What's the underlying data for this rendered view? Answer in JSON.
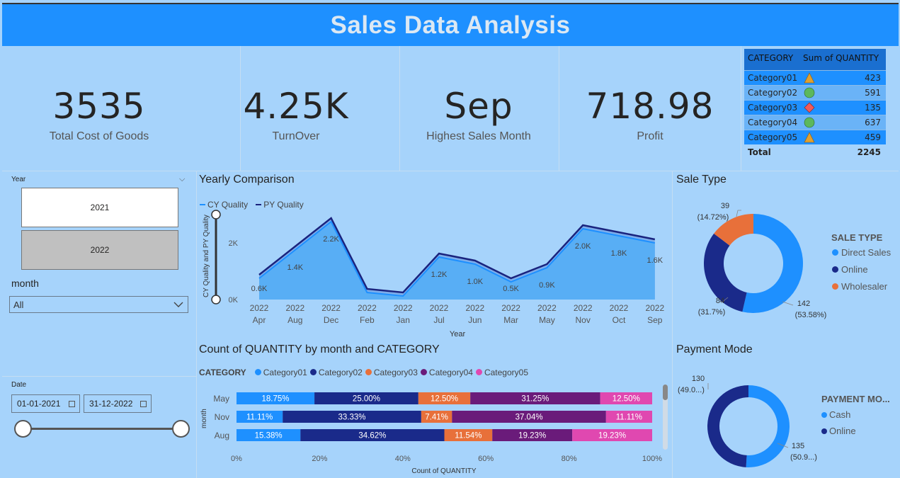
{
  "header": {
    "title": "Sales Data Analysis"
  },
  "kpis": [
    {
      "value": "3535",
      "label": "Total Cost of Goods"
    },
    {
      "value": "4.25K",
      "label": "TurnOver"
    },
    {
      "value": "Sep",
      "label": "Highest Sales Month"
    },
    {
      "value": "718.98",
      "label": "Profit"
    }
  ],
  "category_table": {
    "headers": [
      "CATEGORY",
      "Sum of QUANTITY"
    ],
    "rows": [
      {
        "name": "Category01",
        "icon": "triangle-warning-icon",
        "qty": "423"
      },
      {
        "name": "Category02",
        "icon": "circle-ok-icon",
        "qty": "591"
      },
      {
        "name": "Category03",
        "icon": "diamond-alert-icon",
        "qty": "135"
      },
      {
        "name": "Category04",
        "icon": "circle-ok-icon",
        "qty": "637"
      },
      {
        "name": "Category05",
        "icon": "triangle-warning-icon",
        "qty": "459"
      }
    ],
    "total_label": "Total",
    "total_value": "2245",
    "colors": {
      "triangle": "#e0a030",
      "circle": "#5cb85c",
      "diamond": "#ef5a5a"
    }
  },
  "year_slicer": {
    "label": "Year",
    "options": [
      "2021",
      "2022"
    ],
    "selected": "2022"
  },
  "month_slicer": {
    "label": "month",
    "value": "All"
  },
  "date_slicer": {
    "label": "Date",
    "start": "01-01-2021",
    "end": "31-12-2022"
  },
  "yearly": {
    "title": "Yearly Comparison",
    "legend": [
      "CY Quality",
      "PY Quality"
    ],
    "ylabel": "CY Quality and PY Quality",
    "xlabel": "Year",
    "yticks": [
      "2K",
      "0K"
    ]
  },
  "sale_type": {
    "title": "Sale Type",
    "legend_title": "SALE TYPE",
    "labels": [
      "Direct Sales",
      "Online",
      "Wholesaler"
    ],
    "value_labels": [
      {
        "value": "142",
        "pct": "(53.58%)"
      },
      {
        "value": "84",
        "pct": "(31.7%)"
      },
      {
        "value": "39",
        "pct": "(14.72%)"
      }
    ]
  },
  "payment": {
    "title": "Payment Mode",
    "legend_title": "PAYMENT MO...",
    "labels": [
      "Cash",
      "Online"
    ],
    "value_labels": [
      {
        "value": "135",
        "pct": "(50.9...)"
      },
      {
        "value": "130",
        "pct": "(49.0...)"
      }
    ]
  },
  "stacked": {
    "title": "Count of QUANTITY by month and CATEGORY",
    "legend_title": "CATEGORY",
    "ylabel": "month",
    "xlabel": "Count of QUANTITY",
    "xticks": [
      "0%",
      "20%",
      "40%",
      "60%",
      "80%",
      "100%"
    ]
  },
  "chart_data": [
    {
      "type": "area",
      "title": "Yearly Comparison",
      "categories": [
        "2022 Apr",
        "2022 Aug",
        "2022 Dec",
        "2022 Feb",
        "2022 Jan",
        "2022 Jul",
        "2022 Jun",
        "2022 Mar",
        "2022 May",
        "2022 Nov",
        "2022 Oct",
        "2022 Sep"
      ],
      "category_lines": [
        [
          "2022",
          "Apr"
        ],
        [
          "2022",
          "Aug"
        ],
        [
          "2022",
          "Dec"
        ],
        [
          "2022",
          "Feb"
        ],
        [
          "2022",
          "Jan"
        ],
        [
          "2022",
          "Jul"
        ],
        [
          "2022",
          "Jun"
        ],
        [
          "2022",
          "Mar"
        ],
        [
          "2022",
          "May"
        ],
        [
          "2022",
          "Nov"
        ],
        [
          "2022",
          "Oct"
        ],
        [
          "2022",
          "Sep"
        ]
      ],
      "series": [
        {
          "name": "CY Quality",
          "values": [
            0.6,
            1.4,
            2.2,
            0.2,
            0.1,
            1.2,
            1.0,
            0.5,
            0.9,
            2.0,
            1.8,
            1.6
          ]
        },
        {
          "name": "PY Quality",
          "values": [
            0.7,
            1.5,
            2.3,
            0.3,
            0.2,
            1.3,
            1.1,
            0.6,
            1.0,
            2.1,
            1.9,
            1.7
          ]
        }
      ],
      "data_labels": [
        "0.6K",
        "1.4K",
        "2.2K",
        "",
        "",
        "1.2K",
        "1.0K",
        "0.5K",
        "0.9K",
        "2.0K",
        "1.8K",
        "1.6K"
      ],
      "ylim": [
        0,
        2.4
      ],
      "colors": [
        "#1e90ff",
        "#1a237e"
      ]
    },
    {
      "type": "pie",
      "title": "Sale Type",
      "labels": [
        "Direct Sales",
        "Online",
        "Wholesaler"
      ],
      "values": [
        142,
        84,
        39
      ],
      "colors": [
        "#1e90ff",
        "#1a2a8a",
        "#e8703a"
      ]
    },
    {
      "type": "pie",
      "title": "Payment Mode",
      "labels": [
        "Cash",
        "Online"
      ],
      "values": [
        135,
        130
      ],
      "colors": [
        "#1e90ff",
        "#1a2a8a"
      ]
    },
    {
      "type": "bar",
      "title": "Count of QUANTITY by month and CATEGORY",
      "categories": [
        "May",
        "Nov",
        "Aug"
      ],
      "series": [
        {
          "name": "Category01",
          "values": [
            18.75,
            11.11,
            15.38
          ],
          "labels": [
            "18.75%",
            "11.11%",
            "15.38%"
          ]
        },
        {
          "name": "Category02",
          "values": [
            25.0,
            33.33,
            34.62
          ],
          "labels": [
            "25.00%",
            "33.33%",
            "34.62%"
          ]
        },
        {
          "name": "Category03",
          "values": [
            12.5,
            7.41,
            11.54
          ],
          "labels": [
            "12.50%",
            "7.41%",
            "11.54%"
          ]
        },
        {
          "name": "Category04",
          "values": [
            31.25,
            37.04,
            19.23
          ],
          "labels": [
            "31.25%",
            "37.04%",
            "19.23%"
          ]
        },
        {
          "name": "Category05",
          "values": [
            12.5,
            11.11,
            19.23
          ],
          "labels": [
            "12.50%",
            "11.11%",
            "19.23%"
          ]
        }
      ],
      "colors": [
        "#1e90ff",
        "#1a2a8a",
        "#e8703a",
        "#6a1b7a",
        "#e048b0"
      ],
      "xlim": [
        0,
        100
      ]
    }
  ]
}
